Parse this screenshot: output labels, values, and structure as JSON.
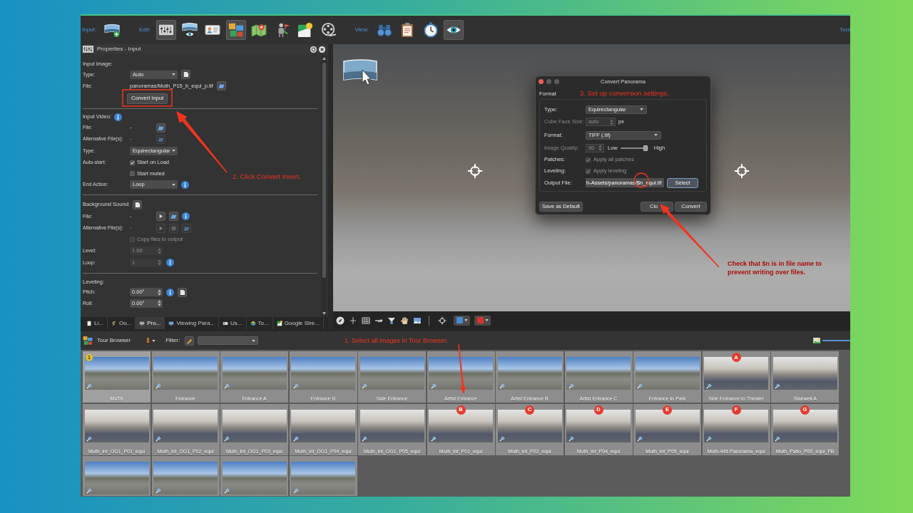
{
  "toolbar": {
    "groups": [
      {
        "label": "Input:",
        "buttons": [
          {
            "on": false
          }
        ]
      },
      {
        "label": "Edit:",
        "buttons": [
          {
            "on": true
          },
          {
            "on": false
          },
          {
            "on": false
          },
          {
            "on": true
          },
          {
            "on": false
          },
          {
            "on": false
          },
          {
            "on": false
          },
          {
            "on": false
          }
        ]
      },
      {
        "label": "View:",
        "buttons": [
          {
            "on": false
          },
          {
            "on": false
          },
          {
            "on": false
          },
          {
            "on": true
          }
        ]
      }
    ],
    "end_label": "Tool"
  },
  "properties": {
    "title": "Properties - Input",
    "annotation": "2. Click Convert Invert.",
    "sections": [
      {
        "heading": "Input Image:",
        "rows": [
          {
            "kind": "dropdown",
            "label": "Type:",
            "value": "Auto",
            "disabled": false
          },
          {
            "kind": "file",
            "label": "File:",
            "value": "panoramas/Muth_P15_b_equi_p.tif",
            "disabled": false
          },
          {
            "kind": "button",
            "text": "Convert Input",
            "disabled": false
          }
        ]
      },
      {
        "heading": "Input Video:",
        "rows": [
          {
            "kind": "file",
            "label": "File:",
            "value": "-",
            "disabled": false
          },
          {
            "kind": "file",
            "label": "Alternative File(s):",
            "value": "-",
            "disabled": true
          },
          {
            "kind": "dropdown",
            "label": "Type:",
            "value": "Equirectangular",
            "disabled": false
          },
          {
            "kind": "checkbox",
            "label": "Auto-start:",
            "text": "Start on Load",
            "checked": true,
            "disabled": false
          },
          {
            "kind": "checkbox",
            "text": "Start muted",
            "checked": false,
            "disabled": false
          },
          {
            "kind": "dropdown",
            "label": "End Action:",
            "value": "Loop",
            "disabled": false
          }
        ]
      },
      {
        "heading": "Background Sound:",
        "rows": [
          {
            "kind": "file",
            "label": "File:",
            "value": "-",
            "disabled": false
          },
          {
            "kind": "file",
            "label": "Alternative File(s):",
            "value": "-",
            "disabled": true
          },
          {
            "kind": "checkbox",
            "text": "Copy files to output",
            "checked": false,
            "disabled": true
          },
          {
            "kind": "spin",
            "label": "Level:",
            "value": "1.00",
            "disabled": true
          },
          {
            "kind": "spin",
            "label": "Loop:",
            "value": "1",
            "disabled": true
          }
        ]
      },
      {
        "heading": "Leveling:",
        "rows": [
          {
            "kind": "spin",
            "label": "Pitch:",
            "value": "0.00°",
            "disabled": false
          },
          {
            "kind": "spin",
            "label": "Roll:",
            "value": "0.00°",
            "disabled": false
          }
        ]
      }
    ]
  },
  "panel_tabs": [
    {
      "label": "Li...",
      "selected": false
    },
    {
      "label": "Ou...",
      "selected": false
    },
    {
      "label": "Pro...",
      "selected": true
    },
    {
      "label": "Viewing Para...",
      "selected": false
    },
    {
      "label": "Us...",
      "selected": false
    },
    {
      "label": "To...",
      "selected": false
    },
    {
      "label": "Google Stre...",
      "selected": false
    }
  ],
  "viewer": {
    "annotation": "Check that $n is in file name to prevent writing over files."
  },
  "dialog": {
    "title": "Convert Panorama",
    "group": "Format",
    "annotation": "3. Set up conversion settings.",
    "rows": [
      {
        "kind": "dropdown",
        "label": "Type:",
        "value": "Equirectangular",
        "disabled": false
      },
      {
        "kind": "spin",
        "label": "Cube Face Size:",
        "value": "auto",
        "unit": "px",
        "disabled": true
      },
      {
        "kind": "dropdown",
        "label": "Format:",
        "value": "TIFF (.tif)",
        "disabled": false
      },
      {
        "kind": "slider",
        "label": "Image Quality:",
        "value": "90",
        "low": "Low",
        "high": "High",
        "level": 0.9,
        "disabled": true
      },
      {
        "kind": "checkbox",
        "label": "Patches:",
        "text": "Apply all patches",
        "checked": true,
        "disabled": true
      },
      {
        "kind": "checkbox",
        "label": "Leveling:",
        "text": "Apply leveling",
        "checked": true,
        "disabled": true
      },
      {
        "kind": "file",
        "label": "Output File:",
        "value": "h-Assets/panoramas/$n_equi.tif",
        "button": "Select",
        "disabled": false
      }
    ],
    "buttons": [
      {
        "label": "Save as Default"
      },
      {
        "label": "Clo"
      },
      {
        "label": "Convert"
      }
    ]
  },
  "viewer_toolbar": {
    "swatches": [
      {
        "color": "#4a8ad0"
      },
      {
        "color": "#d9342a"
      }
    ]
  },
  "tour_browser": {
    "title": "Tour Browser",
    "filter_label": "Filter:",
    "annotation": "1. Select all images in Tour Browser.",
    "size_slider": {
      "level": 1
    },
    "thumbnails": [
      {
        "label": "MuTh",
        "kind": "outdoor",
        "selected": true,
        "badge": {
          "kind": "start",
          "text": "1",
          "color": "#e3c22b"
        }
      },
      {
        "label": "Entrance",
        "kind": "outdoor",
        "selected": false
      },
      {
        "label": "Entrance A",
        "kind": "outdoor",
        "selected": false
      },
      {
        "label": "Entrance B",
        "kind": "outdoor",
        "selected": false
      },
      {
        "label": "Side Entrance",
        "kind": "outdoor",
        "selected": false
      },
      {
        "label": "Artist Entrance",
        "kind": "outdoor",
        "selected": false
      },
      {
        "label": "Artist Entrance B",
        "kind": "outdoor",
        "selected": false
      },
      {
        "label": "Artist Entrance C",
        "kind": "outdoor",
        "selected": false
      },
      {
        "label": "Entrance to Park",
        "kind": "outdoor",
        "selected": false
      },
      {
        "label": "Side Entrance to Theater",
        "kind": "indoor",
        "selected": false,
        "badge": {
          "kind": "marker",
          "text": "A",
          "color": "#e23b2e"
        }
      },
      {
        "label": "Stairwell A",
        "kind": "indoor",
        "selected": false
      },
      {
        "label": "Muth_int_OG1_P01_equi",
        "kind": "indoor",
        "selected": false
      },
      {
        "label": "Muth_int_OG1_P02_equi",
        "kind": "indoor",
        "selected": false
      },
      {
        "label": "Muth_int_OG1_P03_equi",
        "kind": "indoor",
        "selected": false
      },
      {
        "label": "Muth_int_OG1_P04_equi",
        "kind": "indoor",
        "selected": false
      },
      {
        "label": "Muth_int_OG1_P05_equi",
        "kind": "indoor",
        "selected": false
      },
      {
        "label": "Muth_int_P01_equi",
        "kind": "indoor",
        "selected": false,
        "badge": {
          "kind": "marker",
          "text": "B",
          "color": "#e23b2e"
        }
      },
      {
        "label": "Muth_int_P02_equi",
        "kind": "indoor",
        "selected": false,
        "badge": {
          "kind": "marker",
          "text": "C",
          "color": "#e23b2e"
        }
      },
      {
        "label": "Muth_int_P04_equi",
        "kind": "indoor",
        "selected": false,
        "badge": {
          "kind": "marker",
          "text": "D",
          "color": "#e23b2e"
        }
      },
      {
        "label": "Muth_int_P05_equi",
        "kind": "indoor",
        "selected": false,
        "badge": {
          "kind": "marker",
          "text": "E",
          "color": "#e23b2e"
        }
      },
      {
        "label": "Muth-446 Panorama_equi",
        "kind": "indoor",
        "selected": false,
        "badge": {
          "kind": "marker",
          "text": "F",
          "color": "#e23b2e"
        }
      },
      {
        "label": "Muth_Patio_P00_equi_FB",
        "kind": "indoor",
        "selected": false,
        "badge": {
          "kind": "marker",
          "text": "G",
          "color": "#e23b2e"
        }
      },
      {
        "kind": "outdoor",
        "selected": false
      },
      {
        "kind": "outdoor",
        "selected": false
      },
      {
        "kind": "outdoor",
        "selected": false
      },
      {
        "kind": "outdoor",
        "selected": false
      }
    ]
  }
}
